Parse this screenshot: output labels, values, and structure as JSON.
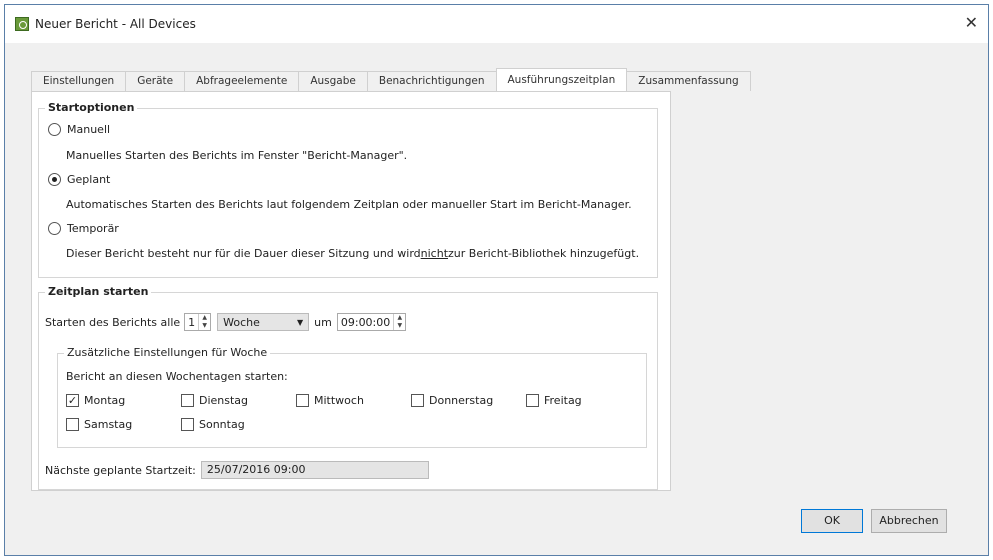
{
  "window": {
    "title": "Neuer Bericht - All Devices",
    "close": "✕"
  },
  "tabs": [
    "Einstellungen",
    "Geräte",
    "Abfrageelemente",
    "Ausgabe",
    "Benachrichtigungen",
    "Ausführungszeitplan",
    "Zusammenfassung"
  ],
  "start_options": {
    "title": "Startoptionen",
    "manual": {
      "label": "Manuell",
      "desc": "Manuelles Starten des Berichts im Fenster \"Bericht-Manager\"."
    },
    "scheduled": {
      "label": "Geplant",
      "desc": "Automatisches Starten des Berichts laut folgendem Zeitplan oder manueller Start im Bericht-Manager."
    },
    "temporary": {
      "label": "Temporär",
      "desc_pre": "Dieser Bericht besteht nur für die Dauer dieser Sitzung und wird ",
      "desc_em": "nicht",
      "desc_post": " zur Bericht-Bibliothek hinzugefügt."
    }
  },
  "schedule": {
    "title": "Zeitplan starten",
    "every_label": "Starten des Berichts alle",
    "every_value": "1",
    "unit": "Woche",
    "at_label": "um",
    "time": "09:00:00",
    "weekly": {
      "title": "Zusätzliche Einstellungen für Woche",
      "days_label": "Bericht an diesen Wochentagen starten:",
      "days": [
        {
          "label": "Montag",
          "checked": true
        },
        {
          "label": "Dienstag",
          "checked": false
        },
        {
          "label": "Mittwoch",
          "checked": false
        },
        {
          "label": "Donnerstag",
          "checked": false
        },
        {
          "label": "Freitag",
          "checked": false
        },
        {
          "label": "Samstag",
          "checked": false
        },
        {
          "label": "Sonntag",
          "checked": false
        }
      ]
    },
    "next_label": "Nächste geplante Startzeit:",
    "next_value": "25/07/2016 09:00"
  },
  "buttons": {
    "ok": "OK",
    "cancel": "Abbrechen"
  }
}
